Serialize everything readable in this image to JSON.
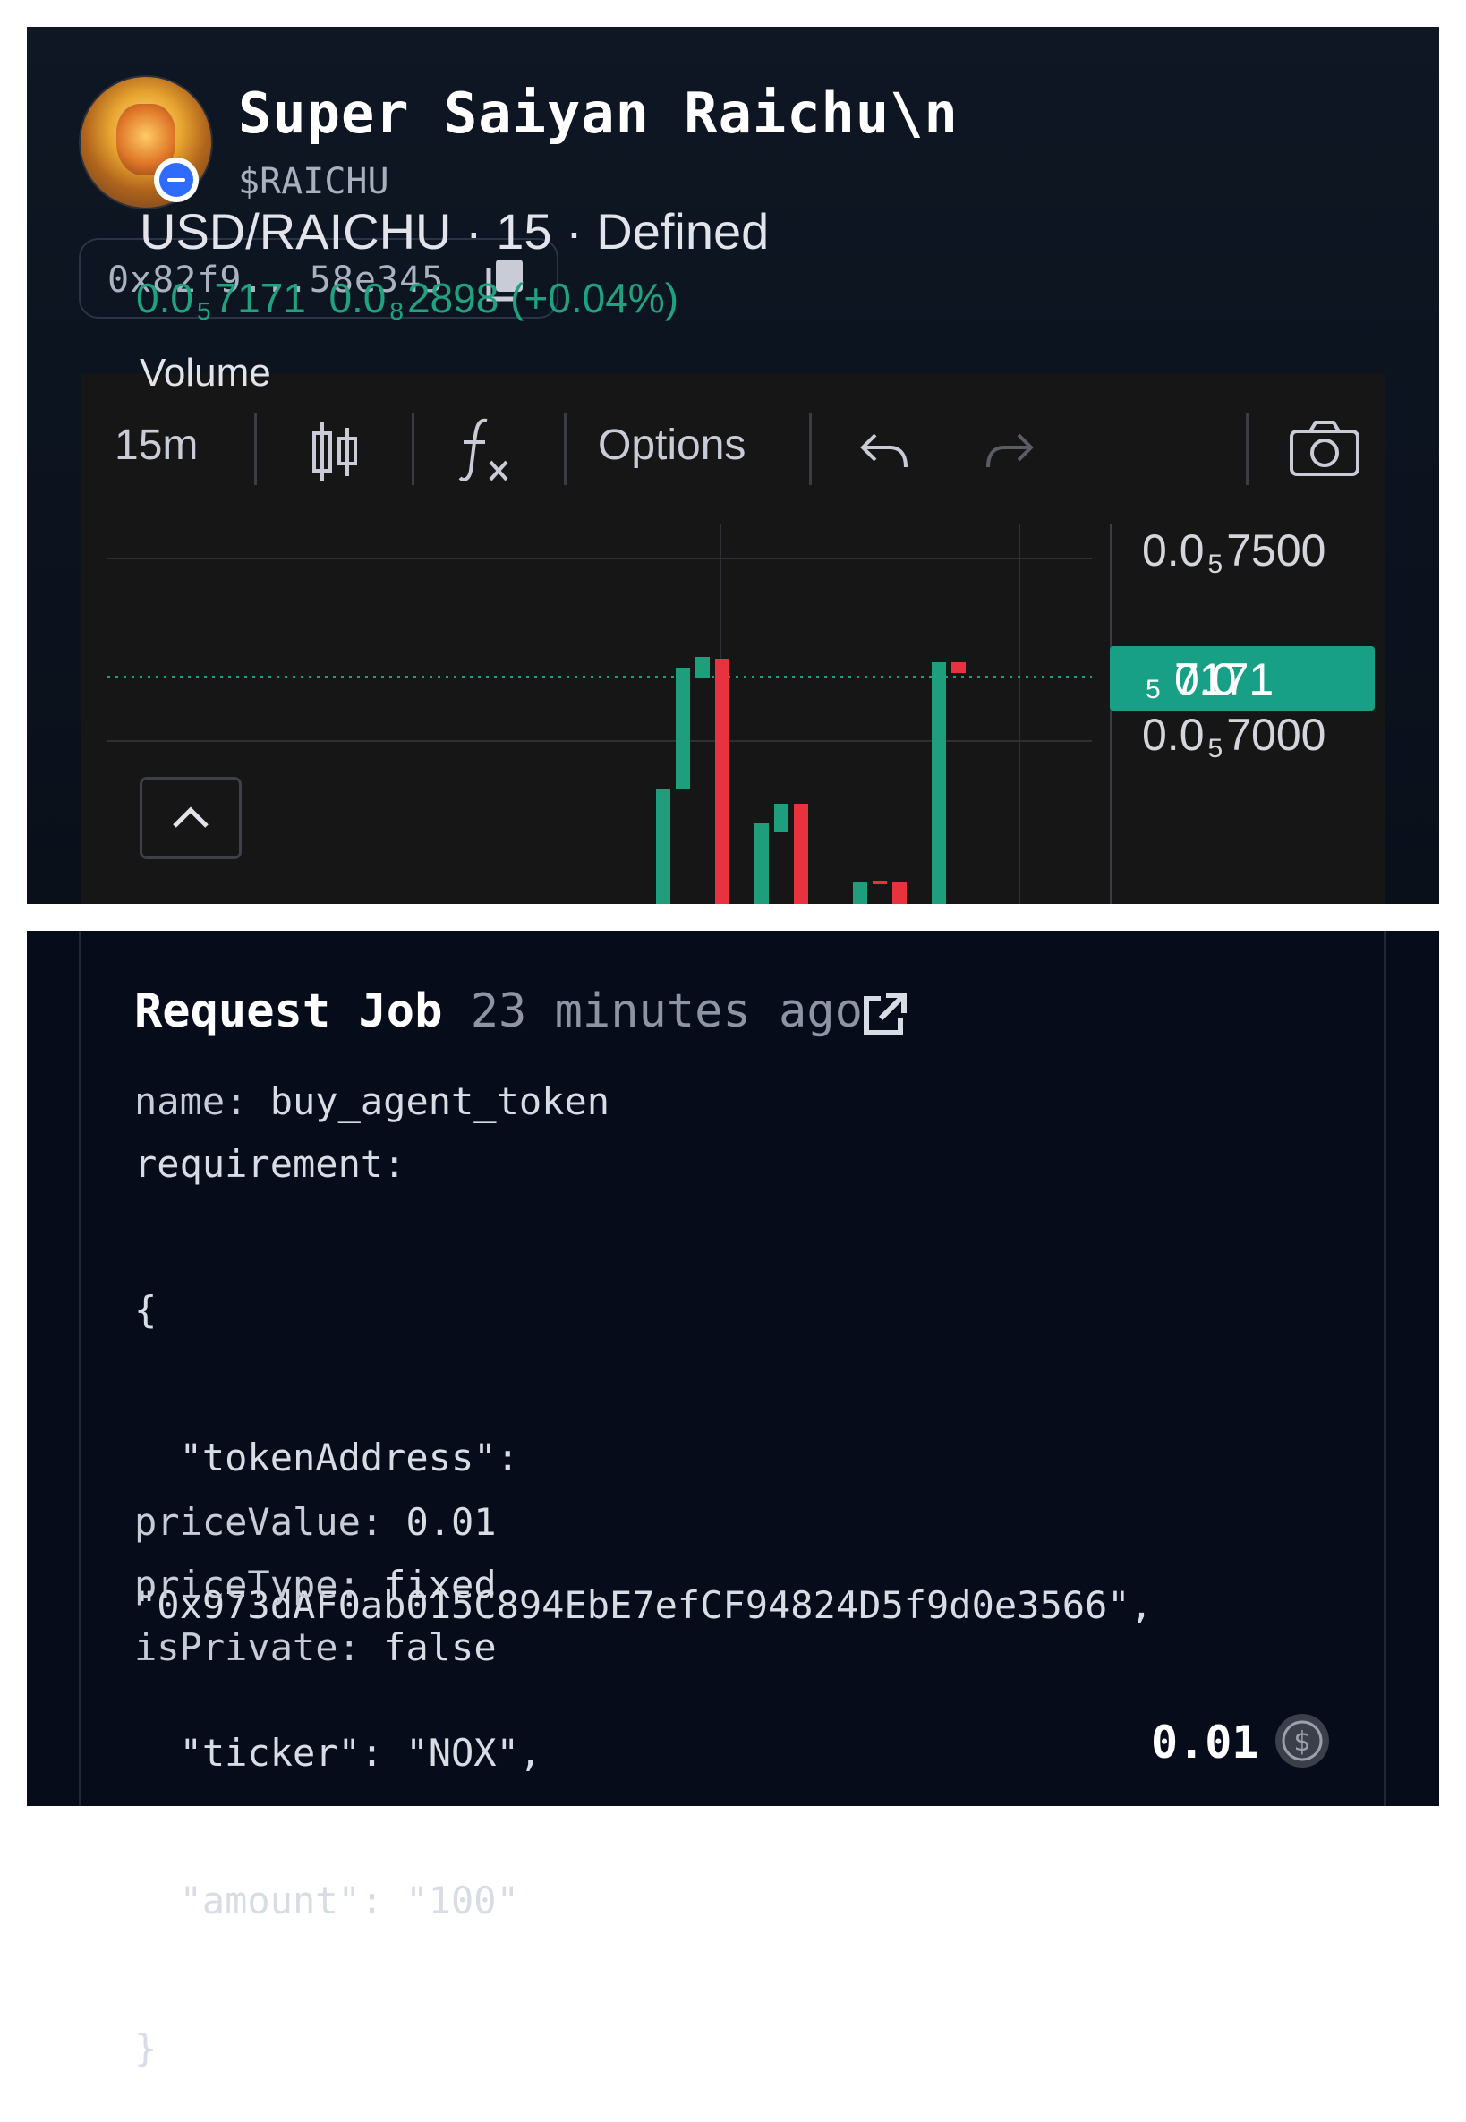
{
  "token": {
    "name": "Super Saiyan Raichu\\n",
    "ticker": "$RAICHU",
    "address_short": "0x82f9...58e345"
  },
  "chart": {
    "toolbar": {
      "interval": "15m",
      "options_label": "Options"
    },
    "legend": {
      "pair_title": "USD/RAICHU · 15 · Defined",
      "price_prefix": "0.0",
      "price_sub": "5",
      "price_tail": "7171",
      "change_prefix": "0.0",
      "change_sub": "8",
      "change_tail": "2898",
      "change_pct": "(+0.04%)",
      "volume_label": "Volume"
    },
    "axis": [
      {
        "prefix": "0.0",
        "sub": "5",
        "tail": "7500"
      },
      {
        "prefix": "0.0",
        "sub": "5",
        "tail": "7000"
      }
    ],
    "current_price": {
      "prefix": "0.0",
      "sub": "5",
      "tail": "7171"
    },
    "colors": {
      "up": "#1f9e7c",
      "down": "#e8333e",
      "price_tag": "#17a085"
    }
  },
  "job": {
    "title": "Request Job",
    "time_ago": "23 minutes ago",
    "name_key": "name:",
    "name_value": "buy_agent_token",
    "requirement_key": "requirement:",
    "requirement_lines": [
      "{",
      "  \"tokenAddress\":",
      "\"0x973dAF0ab015C894EbE7efCF94824D5f9d0e3566\",",
      "  \"ticker\": \"NOX\",",
      "  \"amount\": \"100\"",
      "}"
    ],
    "price_value_key": "priceValue:",
    "price_value": "0.01",
    "price_type_key": "priceType:",
    "price_type": "fixed",
    "is_private_key": "isPrivate:",
    "is_private": "false",
    "total_price": "0.01"
  }
}
